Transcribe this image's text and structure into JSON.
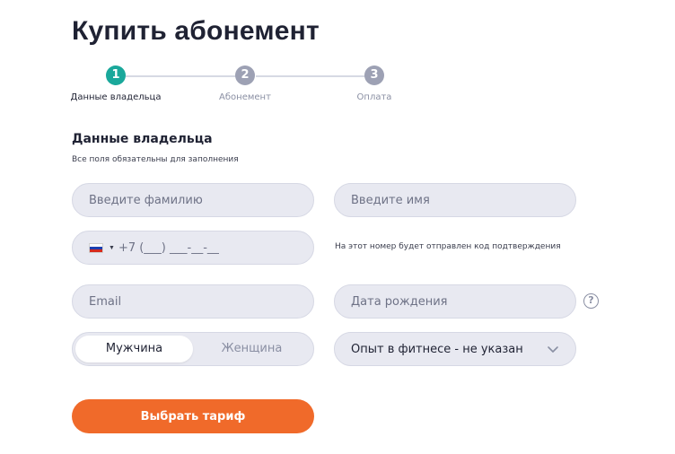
{
  "page": {
    "title": "Купить абонемент"
  },
  "stepper": {
    "steps": [
      {
        "number": "1",
        "label": "Данные владельца",
        "state": "active"
      },
      {
        "number": "2",
        "label": "Абонемент",
        "state": "inactive"
      },
      {
        "number": "3",
        "label": "Оплата",
        "state": "inactive"
      }
    ]
  },
  "section": {
    "title": "Данные владельца",
    "subtitle": "Все поля обязательны для заполнения"
  },
  "form": {
    "last_name_placeholder": "Введите фамилию",
    "first_name_placeholder": "Введите имя",
    "phone": {
      "country_flag": "russia-flag-icon",
      "mask": "+7 (___) ___-__-__",
      "hint": "На этот номер будет отправлен код подтверждения"
    },
    "email_placeholder": "Email",
    "birthdate_placeholder": "Дата рождения",
    "help_icon_glyph": "?",
    "gender": {
      "options": [
        "Мужчина",
        "Женщина"
      ],
      "selected": "Мужчина"
    },
    "fitness_level": {
      "value": "Опыт в фитнесе - не указан"
    },
    "submit_label": "Выбрать тариф"
  },
  "colors": {
    "accent_active_step": "#1aa89b",
    "inactive_step": "#9da1b4",
    "cta": "#f06a2a",
    "field_bg": "#e8e9f1"
  }
}
